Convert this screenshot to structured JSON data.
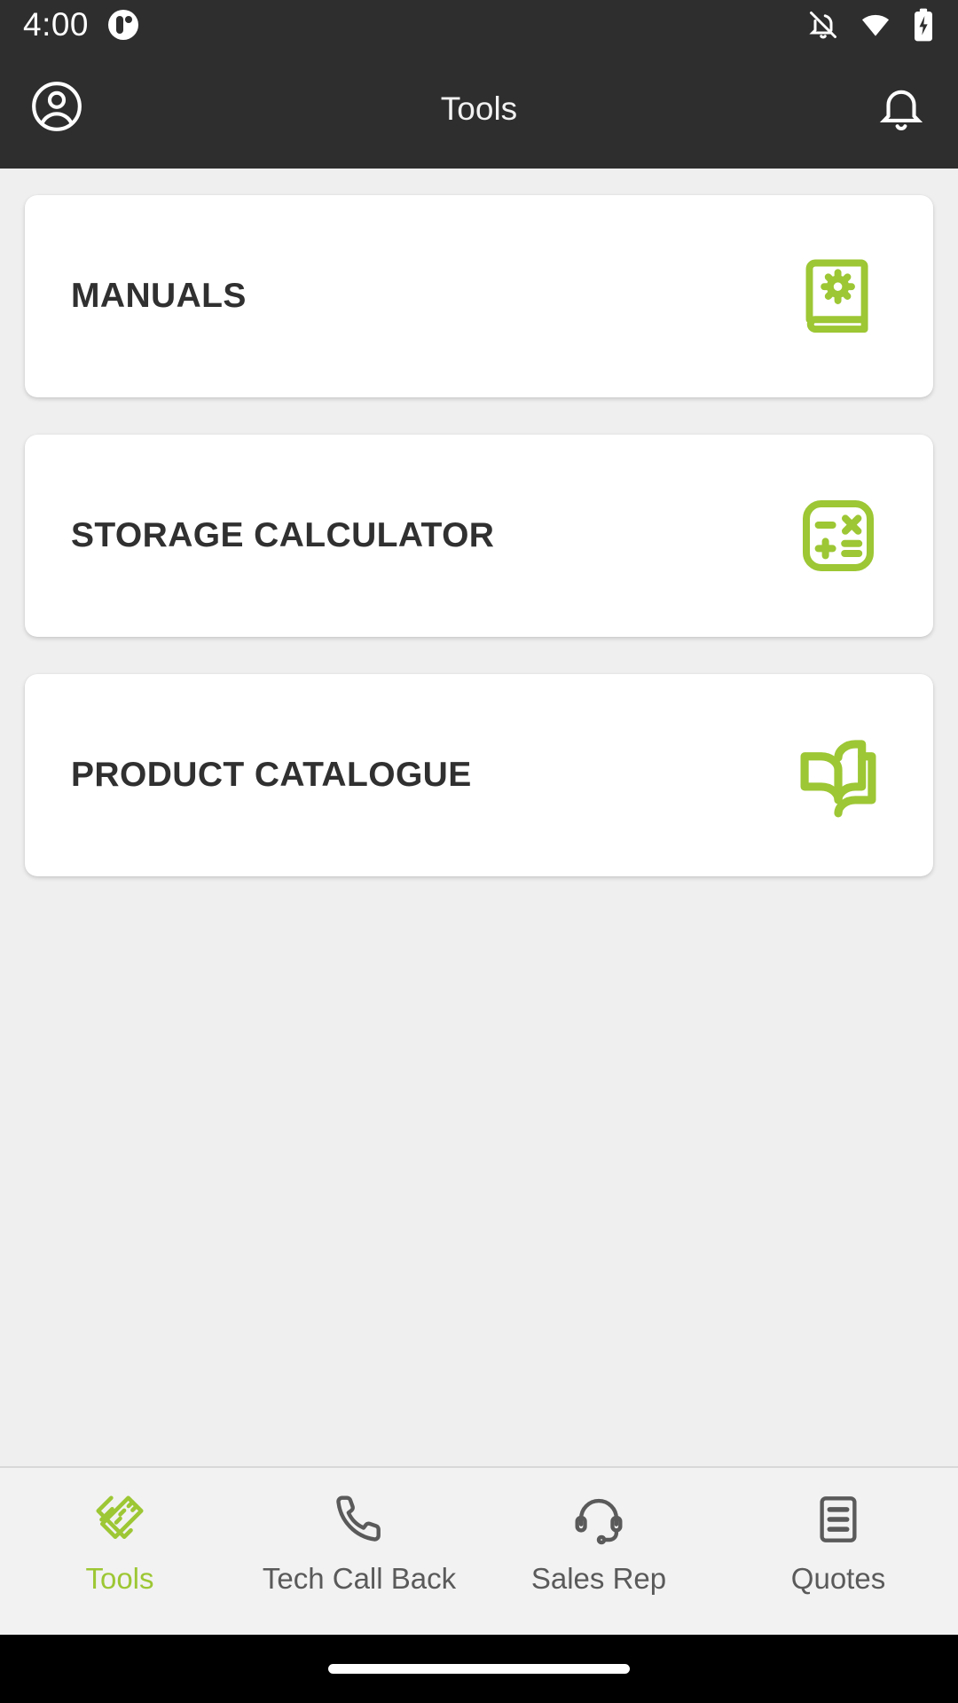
{
  "status_bar": {
    "time": "4:00",
    "app_badge_icon": "app-badge-icon",
    "icons": [
      "notifications-off-icon",
      "wifi-icon",
      "battery-charging-icon"
    ]
  },
  "header": {
    "title": "Tools",
    "account_icon": "account-circle-icon",
    "notification_icon": "bell-icon"
  },
  "main": {
    "cards": [
      {
        "label": "MANUALS",
        "icon": "book-gear-icon"
      },
      {
        "label": "STORAGE CALCULATOR",
        "icon": "calculator-icon"
      },
      {
        "label": "PRODUCT CATALOGUE",
        "icon": "open-book-icon"
      }
    ]
  },
  "bottom_nav": {
    "items": [
      {
        "label": "Tools",
        "icon": "pencil-ruler-icon",
        "active": true
      },
      {
        "label": "Tech Call Back",
        "icon": "phone-icon",
        "active": false
      },
      {
        "label": "Sales Rep",
        "icon": "headset-icon",
        "active": false
      },
      {
        "label": "Quotes",
        "icon": "document-lines-icon",
        "active": false
      }
    ]
  },
  "colors": {
    "accent_green": "#9dc734",
    "header_dark": "#2e2e2e",
    "page_background": "#efefef",
    "card_white": "#ffffff",
    "text_dark": "#303030",
    "nav_inactive": "#5a5a5a"
  }
}
